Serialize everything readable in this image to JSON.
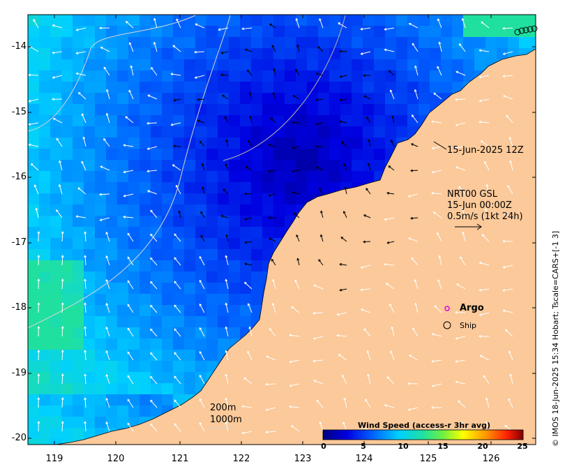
{
  "chart_data": {
    "type": "heatmap",
    "x_ticks": [
      "119",
      "120",
      "121",
      "122",
      "123",
      "124",
      "125",
      "126"
    ],
    "y_ticks": [
      "-14",
      "-15",
      "-16",
      "-17",
      "-18",
      "-19",
      "-20"
    ],
    "xlim": [
      118.6,
      126.7
    ],
    "ylim": [
      -20.1,
      -13.5
    ],
    "colorbar": {
      "title": "Wind Speed (access-r 3hr avg)",
      "ticks": [
        "0",
        "5",
        "10",
        "15",
        "20",
        "25"
      ],
      "range": [
        0,
        25
      ]
    }
  },
  "annotations": {
    "time_label": "15-Jun-2025 12Z",
    "product": "NRT00 GSL",
    "product_time": "15-Jun 00:00Z",
    "scale": "0.5m/s (1kt 24h)"
  },
  "legend": {
    "argo": "Argo",
    "ship": "Ship",
    "argo_color": "#e000e0"
  },
  "contours": {
    "c200": "200m",
    "c1000": "1000m"
  },
  "credit": "© IMOS 18-Jun-2025 15:34 Hobart; Tscale=CARS+[-1 3]",
  "colors": {
    "land": "#fbc99a",
    "contour": "#d6d6d6"
  }
}
